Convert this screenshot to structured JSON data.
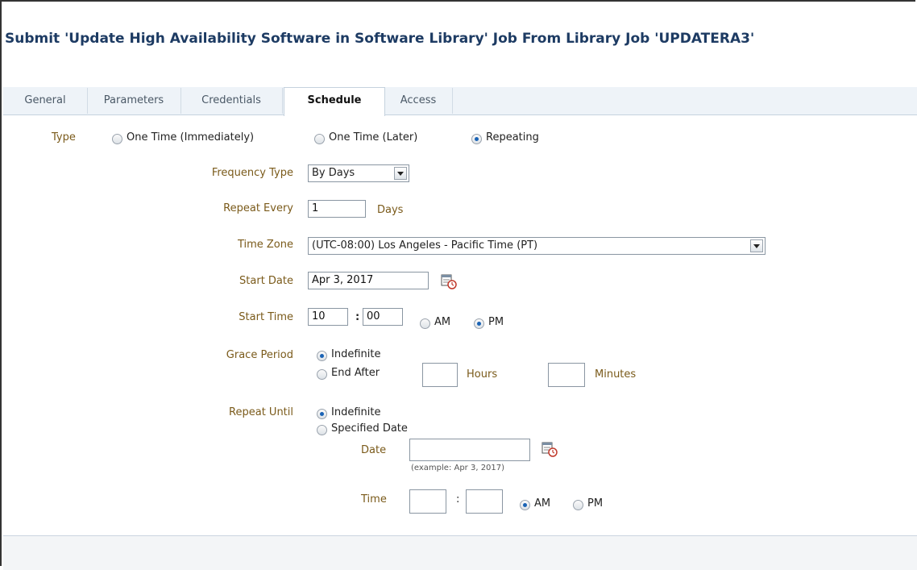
{
  "title": "Submit 'Update High Availability Software in Software Library' Job From Library Job 'UPDATERA3'",
  "tabs": [
    {
      "label": "General"
    },
    {
      "label": "Parameters"
    },
    {
      "label": "Credentials"
    },
    {
      "label": "Schedule",
      "active": true
    },
    {
      "label": "Access"
    }
  ],
  "schedule": {
    "type": {
      "label": "Type",
      "options": [
        "One Time (Immediately)",
        "One Time (Later)",
        "Repeating"
      ],
      "selected": "Repeating"
    },
    "frequency_type": {
      "label": "Frequency Type",
      "value": "By Days"
    },
    "repeat_every": {
      "label": "Repeat Every",
      "value": "1",
      "unit": "Days"
    },
    "time_zone": {
      "label": "Time Zone",
      "value": "(UTC-08:00) Los Angeles - Pacific Time (PT)"
    },
    "start_date": {
      "label": "Start Date",
      "value": "Apr 3, 2017"
    },
    "start_time": {
      "label": "Start Time",
      "hour": "10",
      "separator": ":",
      "minute": "00",
      "am": "AM",
      "pm": "PM",
      "selected": "PM"
    },
    "grace_period": {
      "label": "Grace Period",
      "indefinite": "Indefinite",
      "end_after": "End After",
      "hours_label": "Hours",
      "minutes_label": "Minutes",
      "hours_value": "",
      "minutes_value": "",
      "selected": "Indefinite"
    },
    "repeat_until": {
      "label": "Repeat Until",
      "indefinite": "Indefinite",
      "specified_date": "Specified Date",
      "selected": "Indefinite",
      "date_label": "Date",
      "date_value": "",
      "date_example": "(example: Apr 3, 2017)",
      "time_label": "Time",
      "hour": "",
      "separator": ":",
      "minute": "",
      "am": "AM",
      "pm": "PM",
      "time_selected": "AM"
    }
  },
  "icons": {
    "calendar": "calendar-icon",
    "dropdown": "chevron-down-icon"
  }
}
